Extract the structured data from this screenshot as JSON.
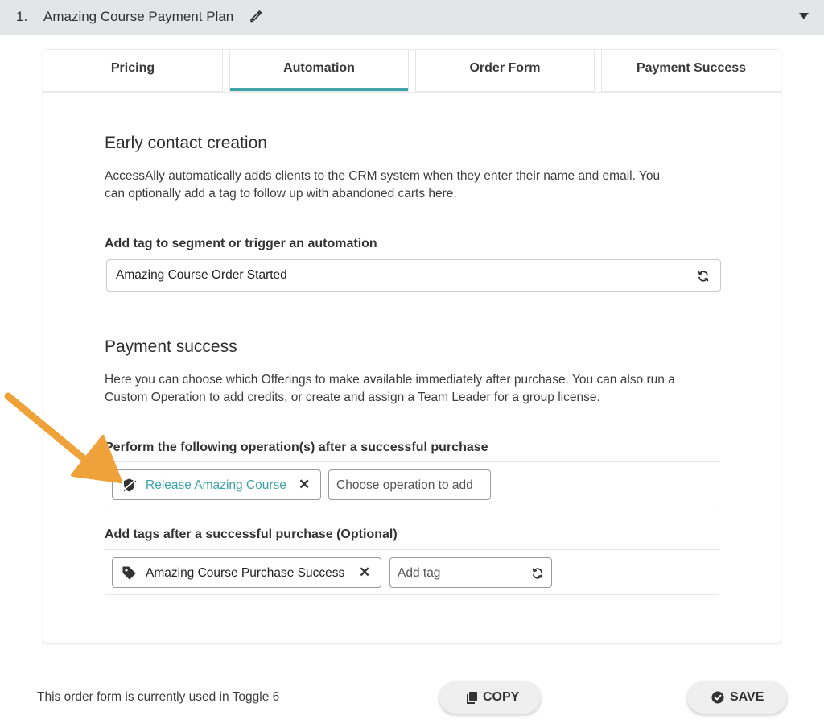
{
  "header": {
    "number": "1.",
    "title": "Amazing Course Payment Plan",
    "edit_icon": "pencil-icon",
    "toggle_icon": "caret-down-icon"
  },
  "tabs": [
    {
      "label": "Pricing",
      "active": false
    },
    {
      "label": "Automation",
      "active": true
    },
    {
      "label": "Order Form",
      "active": false
    },
    {
      "label": "Payment Success",
      "active": false
    }
  ],
  "early_contact": {
    "heading": "Early contact creation",
    "description_line1": "AccessAlly automatically adds clients to the CRM system when they enter their name and email. You",
    "description_line2": "can optionally add a tag to follow up with abandoned carts here.",
    "tag_label": "Add tag to segment or trigger an automation",
    "tag_value": "Amazing Course Order Started"
  },
  "payment_success": {
    "heading": "Payment success",
    "description_line1": "Here you can choose which Offerings to make available immediately after purchase. You can also run a",
    "description_line2": "Custom Operation to add credits, or create and assign a Team Leader for a group license.",
    "operations_label": "Perform the following operation(s) after a successful purchase",
    "operation_chip": "Release Amazing Course",
    "operation_placeholder": "Choose operation to add",
    "tags_label": "Add tags after a successful purchase (Optional)",
    "tag_chip": "Amazing Course Purchase Success",
    "tag_placeholder": "Add tag"
  },
  "footer": {
    "status_text": "This order form is currently used in Toggle 6",
    "copy_label": "COPY",
    "save_label": "SAVE"
  },
  "colors": {
    "accent": "#3fa3a7",
    "arrow": "#f0a23a",
    "header_bg": "#e4e5e7"
  }
}
